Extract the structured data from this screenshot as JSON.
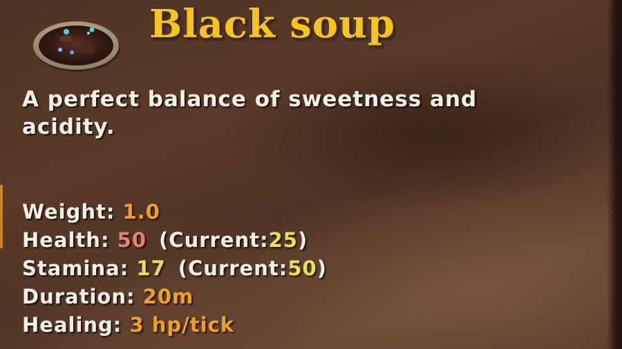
{
  "item": {
    "name": "Black soup",
    "icon": "black-soup-bowl-icon",
    "description": "A perfect balance of sweetness and acidity."
  },
  "stats": {
    "weight": {
      "label": "Weight:",
      "value": "1.0"
    },
    "health": {
      "label": "Health:",
      "value": "50",
      "current_label": "(Current:",
      "current_value": "25",
      "current_close": ")"
    },
    "stamina": {
      "label": "Stamina:",
      "value": "17",
      "current_label": "(Current:",
      "current_value": "50",
      "current_close": ")"
    },
    "duration": {
      "label": "Duration:",
      "value": "20m"
    },
    "healing": {
      "label": "Healing:",
      "value": "3 hp/tick"
    }
  },
  "colors": {
    "title": "#f6c516",
    "text": "#f4f0e8",
    "value_orange": "#f0a21f",
    "value_health": "#ec7f74",
    "value_yellow": "#e8e24a",
    "panel_brown": "#4f3324"
  }
}
